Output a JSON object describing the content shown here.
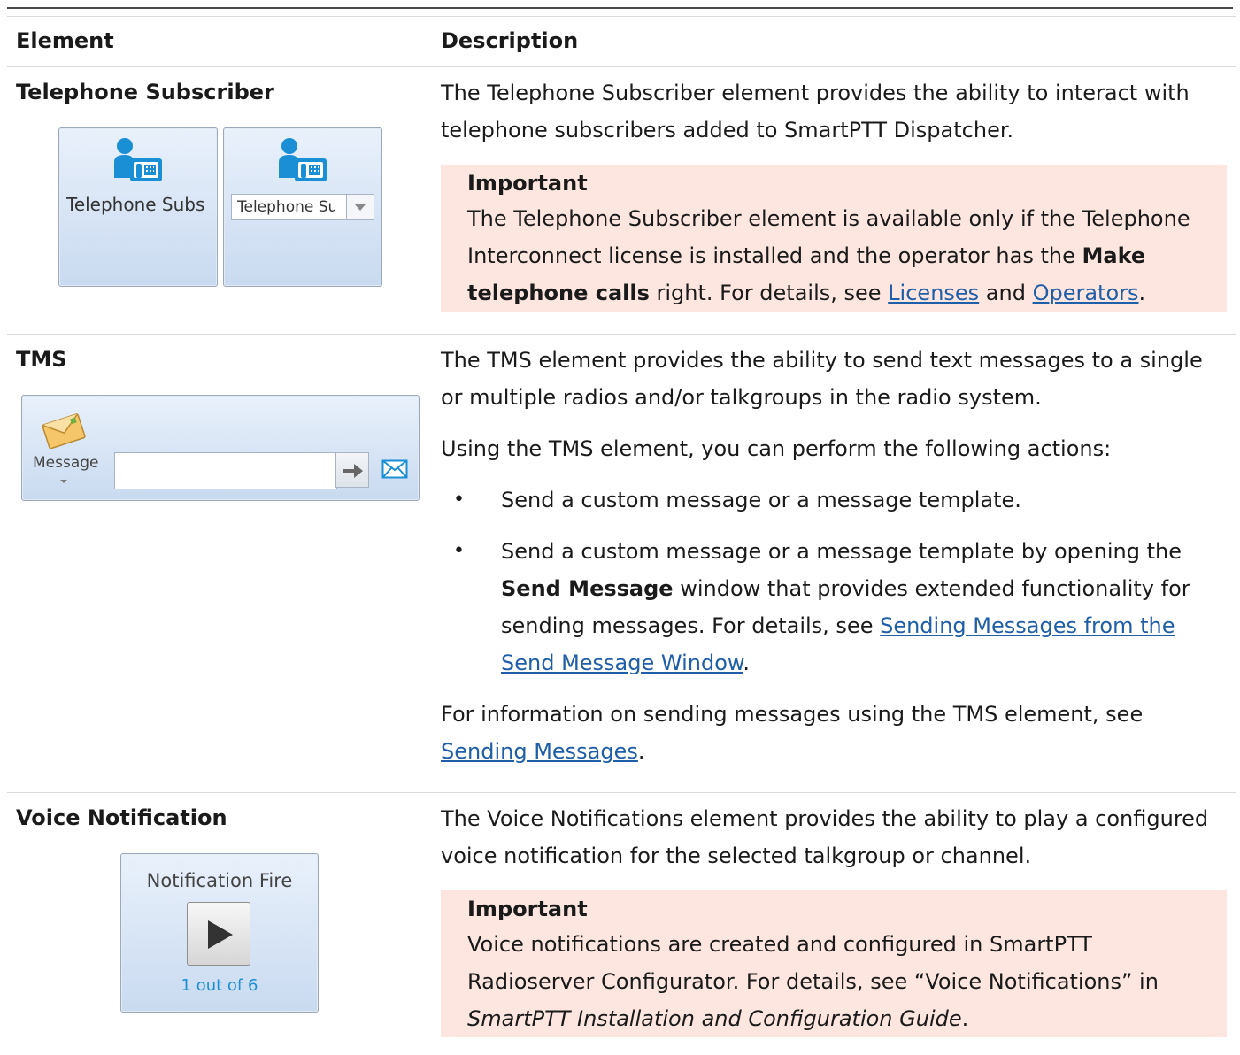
{
  "table": {
    "headers": {
      "element": "Element",
      "description": "Description"
    },
    "rows": [
      {
        "element": "Telephone Subscriber",
        "widget": {
          "tile_label": "Telephone Subs",
          "combo_text": "Telephone Su",
          "icon": "telephone-subscriber-icon"
        },
        "paragraphs": [
          "The Telephone Subscriber element provides the ability to interact with telephone subscribers added to SmartPTT Dispatcher."
        ],
        "important": {
          "title": "Important",
          "text_1": "The Telephone Subscriber element is available only if the Telephone Interconnect license is installed and the operator has the ",
          "bold": "Make telephone calls",
          "text_2": " right. For details, see ",
          "link_1": "Licenses",
          "text_3": " and ",
          "link_2": "Operators",
          "text_4": "."
        }
      },
      {
        "element": "TMS",
        "widget": {
          "message_label": "Message",
          "icon": "envelope-icon"
        },
        "paragraphs": [
          "The TMS element provides the ability to send text messages to a single or multiple radios and/or talkgroups in the radio system.",
          "Using the TMS element, you can perform the following actions:"
        ],
        "bullets": [
          {
            "text": "Send a custom message or a message template."
          },
          {
            "text_1": "Send a custom message or a message template by opening the ",
            "bold": "Send Message",
            "text_2": " window that provides extended functionality for sending messages. For details, see ",
            "link": "Sending Messages from the Send Message Window",
            "text_3": "."
          }
        ],
        "footer": {
          "text": "For information on sending messages using the TMS element, see ",
          "link": "Sending Messages",
          "end": "."
        }
      },
      {
        "element": "Voice Notification",
        "widget": {
          "title": "Notification Fire",
          "counter": "1 out of 6",
          "icon": "play-icon"
        },
        "paragraphs": [
          "The Voice Notifications element provides the ability to play a configured voice notification for the selected talkgroup or channel."
        ],
        "important": {
          "title": "Important",
          "text_1": "Voice notifications are created and configured in SmartPTT Radioserver Configurator. For details, see “Voice Notifications” in ",
          "italic": "SmartPTT Installation and Configuration Guide",
          "text_2": "."
        }
      }
    ]
  },
  "colors": {
    "important_bg": "#fde6df",
    "link": "#1f5ea8",
    "tile_gradient_top": "#e9f1fb",
    "tile_gradient_bottom": "#c9daf0",
    "icon_blue": "#1a8fd6"
  }
}
